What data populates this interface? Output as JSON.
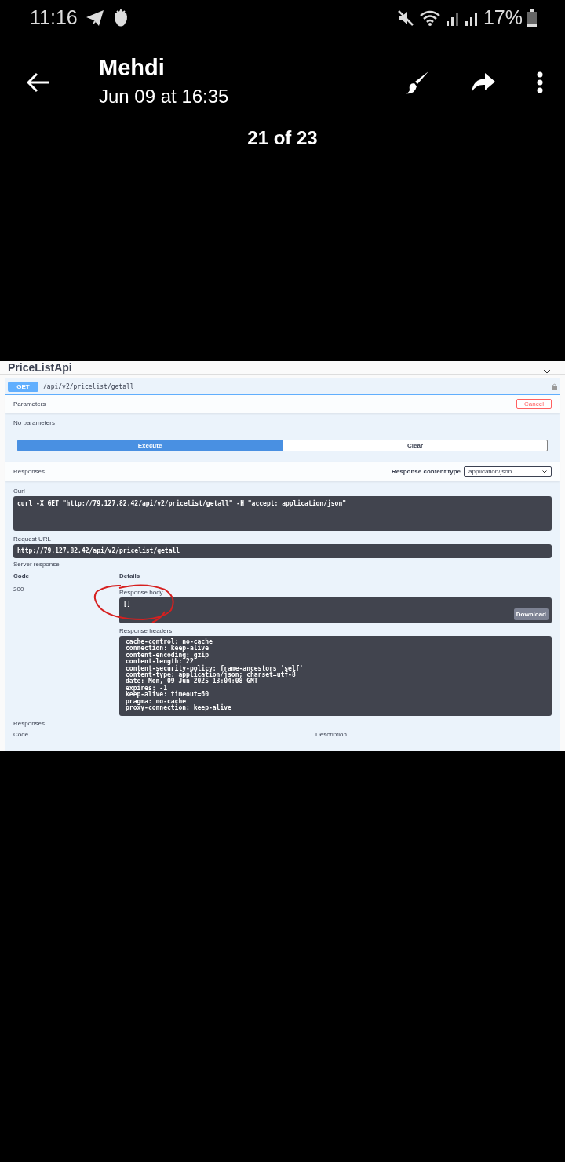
{
  "status_bar": {
    "time": "11:16",
    "battery": "17%"
  },
  "header": {
    "sender": "Mehdi",
    "date": "Jun 09 at 16:35"
  },
  "counter": "21 of 23",
  "image": {
    "section_title": "PriceListApi",
    "operation": {
      "method": "GET",
      "path": "/api/v2/pricelist/getall"
    },
    "parameters": {
      "title": "Parameters",
      "cancel": "Cancel",
      "empty": "No parameters"
    },
    "buttons": {
      "execute": "Execute",
      "clear": "Clear"
    },
    "responses_header": {
      "title": "Responses",
      "content_type_label": "Response content type",
      "content_type": "application/json"
    },
    "curl": {
      "label": "Curl",
      "command": "curl -X GET \"http://79.127.82.42/api/v2/pricelist/getall\" -H \"accept: application/json\""
    },
    "request_url": {
      "label": "Request URL",
      "url": "http://79.127.82.42/api/v2/pricelist/getall"
    },
    "server_response": {
      "title": "Server response",
      "code_header": "Code",
      "details_header": "Details",
      "code": "200",
      "body_label": "Response body",
      "body": "[]",
      "download": "Download",
      "headers_label": "Response headers",
      "headers": [
        "cache-control: no-cache",
        "connection: keep-alive",
        "content-encoding: gzip",
        "content-length: 22",
        "content-security-policy: frame-ancestors 'self'",
        "content-type: application/json; charset=utf-8",
        "date: Mon, 09 Jun 2025 13:04:08 GMT",
        "expires: -1",
        "keep-alive: timeout=60",
        "pragma: no-cache",
        "proxy-connection: keep-alive"
      ]
    },
    "responses": {
      "title": "Responses",
      "code_header": "Code",
      "description_header": "Description"
    }
  }
}
